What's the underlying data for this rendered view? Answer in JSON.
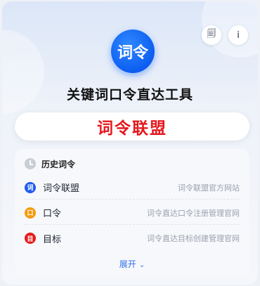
{
  "header": {
    "logo_text": "词令",
    "title": "关键词口令直达工具",
    "actions": [
      {
        "name": "save-icon",
        "glyph": "🗐"
      },
      {
        "name": "info-icon",
        "glyph": "i"
      }
    ]
  },
  "hero": {
    "text": "词令联盟"
  },
  "history": {
    "label": "历史词令",
    "items": [
      {
        "badge": "词",
        "color": "#1e5bf0",
        "name": "词令联盟",
        "desc": "词令联盟官方网站"
      },
      {
        "badge": "口",
        "color": "#f59a0c",
        "name": "口令",
        "desc": "词令直达口令注册管理官网"
      },
      {
        "badge": "目",
        "color": "#e51c1c",
        "name": "目标",
        "desc": "词令直达目标创建管理官网"
      }
    ],
    "expand_label": "展开",
    "expand_icon": "chevron-down-icon"
  }
}
